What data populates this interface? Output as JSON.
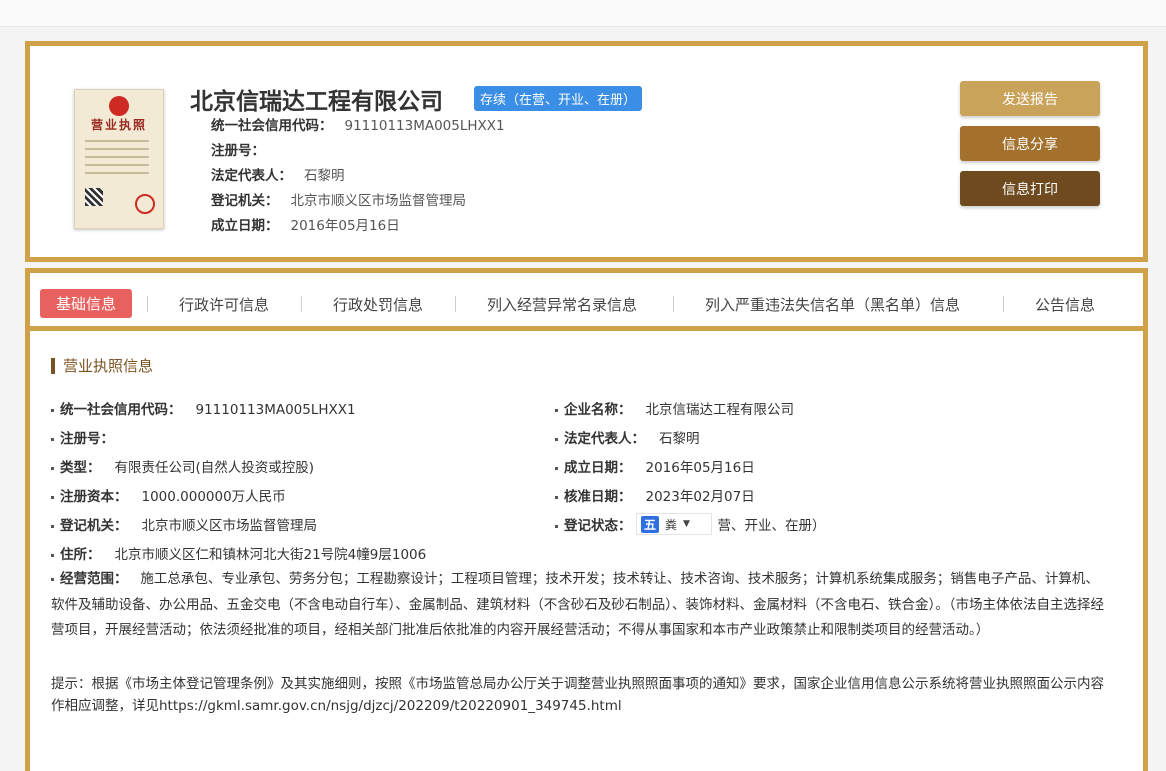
{
  "header": {
    "company_name": "北京信瑞达工程有限公司",
    "status": "存续（在营、开业、在册）",
    "rows": [
      {
        "label": "统一社会信用代码：",
        "value": "91110113MA005LHXX1"
      },
      {
        "label": "注册号：",
        "value": ""
      },
      {
        "label": "法定代表人：",
        "value": "石黎明"
      },
      {
        "label": "登记机关：",
        "value": "北京市顺义区市场监督管理局"
      },
      {
        "label": "成立日期：",
        "value": "2016年05月16日"
      }
    ],
    "license_title": "营业执照",
    "buttons": {
      "send_report": "发送报告",
      "share": "信息分享",
      "print": "信息打印"
    }
  },
  "tabs": [
    "基础信息",
    "行政许可信息",
    "行政处罚信息",
    "列入经营异常名录信息",
    "列入严重违法失信名单（黑名单）信息",
    "公告信息"
  ],
  "section": {
    "title": "营业执照信息",
    "left": [
      {
        "label": "统一社会信用代码：",
        "value": "91110113MA005LHXX1"
      },
      {
        "label": "注册号：",
        "value": ""
      },
      {
        "label": "类型：",
        "value": "有限责任公司(自然人投资或控股)"
      },
      {
        "label": "注册资本：",
        "value": "1000.000000万人民币"
      },
      {
        "label": "登记机关：",
        "value": "北京市顺义区市场监督管理局"
      },
      {
        "label": "住所：",
        "value": "北京市顺义区仁和镇林河北大街21号院4幢9层1006"
      }
    ],
    "right": [
      {
        "label": "企业名称：",
        "value": "北京信瑞达工程有限公司"
      },
      {
        "label": "法定代表人：",
        "value": "石黎明"
      },
      {
        "label": "成立日期：",
        "value": "2016年05月16日"
      },
      {
        "label": "核准日期：",
        "value": "2023年02月07日"
      },
      {
        "label": "登记状态：",
        "value": "营、开业、在册）"
      }
    ],
    "scope_label": "经营范围：",
    "scope": "施工总承包、专业承包、劳务分包；工程勘察设计；工程项目管理；技术开发；技术转让、技术咨询、技术服务；计算机系统集成服务；销售电子产品、计算机、软件及辅助设备、办公用品、五金交电（不含电动自行车）、金属制品、建筑材料（不含砂石及砂石制品）、装饰材料、金属材料（不含电石、铁合金）。（市场主体依法自主选择经营项目，开展经营活动；依法须经批准的项目，经相关部门批准后依批准的内容开展经营活动；不得从事国家和本市产业政策禁止和限制类项目的经营活动。）",
    "note": "提示：根据《市场主体登记管理条例》及其实施细则，按照《市场监管总局办公厅关于调整营业执照照面事项的通知》要求，国家企业信用信息公示系统将营业执照照面公示内容作相应调整，详见https://gkml.samr.gov.cn/nsjg/djzcj/202209/t20220901_349745.html"
  },
  "ime": {
    "mode": "五",
    "label": "粪"
  }
}
